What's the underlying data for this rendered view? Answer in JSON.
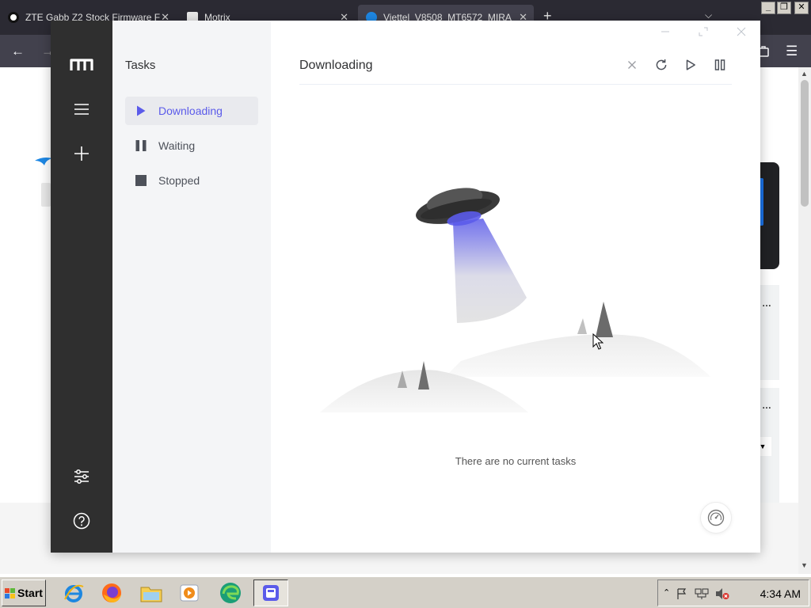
{
  "browser": {
    "tabs": [
      {
        "title": "ZTE Gabb Z2 Stock Firmware F",
        "active": false
      },
      {
        "title": "Motrix",
        "active": false
      },
      {
        "title": "Viettel_V8508_MT6572_MIRA",
        "active": true
      }
    ],
    "new_tab_icon": "plus-icon",
    "tab_list_icon": "chevron-down-icon",
    "window_controls": [
      "minimize",
      "restore",
      "close"
    ]
  },
  "motrix": {
    "sidebar_title": "Tasks",
    "nav": [
      {
        "label": "Downloading",
        "icon": "play-icon",
        "active": true
      },
      {
        "label": "Waiting",
        "icon": "pause-icon",
        "active": false
      },
      {
        "label": "Stopped",
        "icon": "stop-icon",
        "active": false
      }
    ],
    "rail_icons": [
      "motrix-logo",
      "menu-icon",
      "add-icon",
      "settings-icon",
      "help-icon"
    ],
    "main_title": "Downloading",
    "actions": [
      "close-icon",
      "refresh-icon",
      "play-icon",
      "pause-icon"
    ],
    "empty_text": "There are no current tasks",
    "accent_color": "#5b5bea"
  },
  "taskbar": {
    "start_label": "Start",
    "clock": "4:34 AM",
    "apps": [
      "internet-explorer-icon",
      "firefox-icon",
      "file-explorer-icon",
      "media-player-icon",
      "edge-icon",
      "motrix-icon"
    ]
  }
}
